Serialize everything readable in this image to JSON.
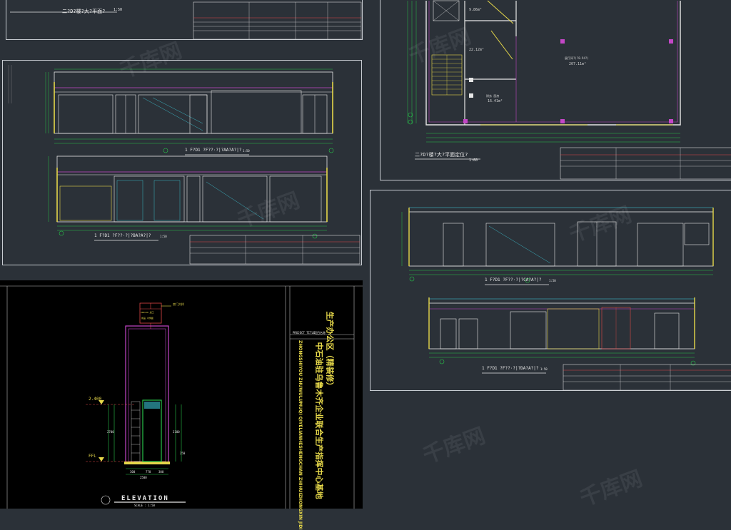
{
  "colors": {
    "background": "#2b3138",
    "sheet_border": "#c8ccd2",
    "outline": "#e6e6e6",
    "dim": "#27c24a",
    "cyan": "#3fd6e6",
    "yellow": "#e6d84a",
    "magenta": "#c447c7",
    "red": "#e04848",
    "blue": "#4a7be6"
  },
  "sheets": {
    "plan_top_left": {
      "caption": "二?D?楼?大?平面?",
      "scale": "1:50"
    },
    "elevations_left": {
      "upper": {
        "caption": "1 F?D1 ?F??·?|?AA?A?|?",
        "scale": "1:50"
      },
      "lower": {
        "caption": "1 F?D1 ?F??·?|?BA?A?|?",
        "scale": "1:50"
      }
    },
    "floor_plan": {
      "caption": "二?D?楼?大?平面定位?",
      "scale": "1:60",
      "rooms": [
        {
          "name": "",
          "area": "9.86m²"
        },
        {
          "name": "",
          "area": "22.12m²"
        },
        {
          "name": "财务 厨房",
          "area": "16.41m²"
        },
        {
          "name": "展厅间?(?8.94?)",
          "area": "207.11m²"
        }
      ]
    },
    "elevations_right": {
      "upper": {
        "caption": "1 F?D1 ?F??·?|?CA?A?|?",
        "scale": "1:50"
      },
      "lower": {
        "caption": "1 F?D1 ?F??·?|?DA?A?|?",
        "scale": "1:50"
      }
    },
    "elevation_detail": {
      "title": "ELEVATION",
      "scale": "SCALE : 1:50",
      "levels": [
        "2.400",
        "FFL"
      ],
      "project_title_label": "PROJECT TITLE",
      "project_title_cn": "项目名称",
      "pinyin": "ZHONGSHIYOU ZHUWULUMUQI QIYELIANHESHENGCHAN ZHIHUIZHONGXIN JIDI",
      "title_line1": "中石油驻乌鲁木齐企业联合生产指挥中心基地",
      "title_line2": "生产办公区（精装修）",
      "tag_label": "房门大样",
      "notes": [
        "200×50 加工",
        "成品 木饰面"
      ],
      "dims": [
        "2700",
        "2100",
        "300",
        "770",
        "300",
        "2500",
        "250"
      ]
    }
  },
  "watermarks": [
    "千库网",
    "千库网",
    "千库网",
    "千库网",
    "千库网",
    "千库网"
  ]
}
